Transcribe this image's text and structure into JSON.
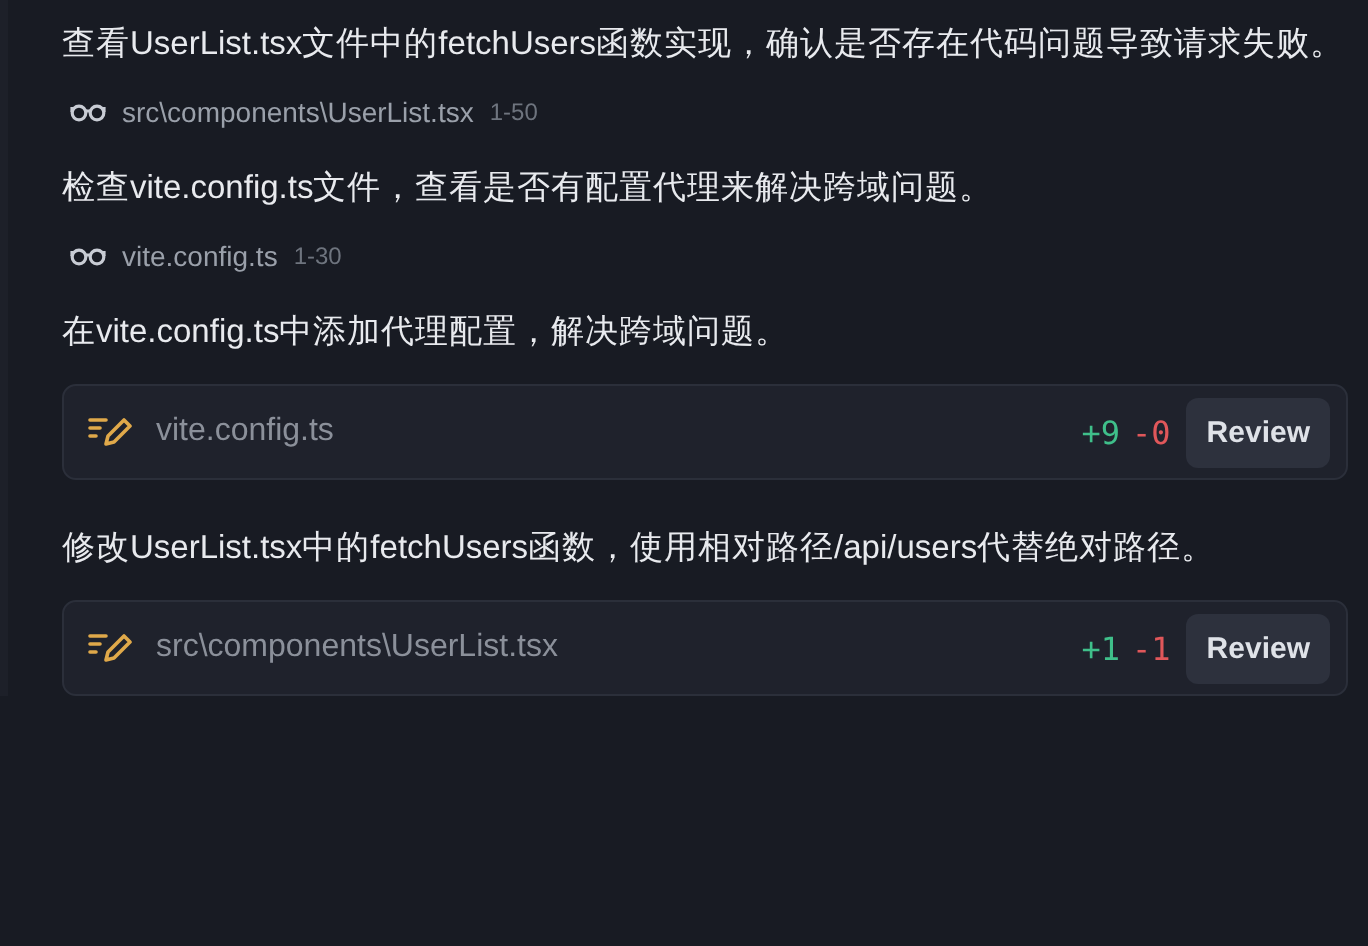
{
  "items": [
    {
      "kind": "message",
      "text": "查看UserList.tsx文件中的fetchUsers函数实现，确认是否存在代码问题导致请求失败。"
    },
    {
      "kind": "read",
      "path": "src\\components\\UserList.tsx",
      "range": "1-50"
    },
    {
      "kind": "message",
      "text": "检查vite.config.ts文件，查看是否有配置代理来解决跨域问题。"
    },
    {
      "kind": "read",
      "path": "vite.config.ts",
      "range": "1-30"
    },
    {
      "kind": "message",
      "text": "在vite.config.ts中添加代理配置，解决跨域问题。"
    },
    {
      "kind": "edit",
      "path": "vite.config.ts",
      "added": "+9",
      "removed": "-0",
      "button": "Review"
    },
    {
      "kind": "message",
      "text": "修改UserList.tsx中的fetchUsers函数，使用相对路径/api/users代替绝对路径。"
    },
    {
      "kind": "edit",
      "path": "src\\components\\UserList.tsx",
      "added": "+1",
      "removed": "-1",
      "button": "Review"
    }
  ]
}
